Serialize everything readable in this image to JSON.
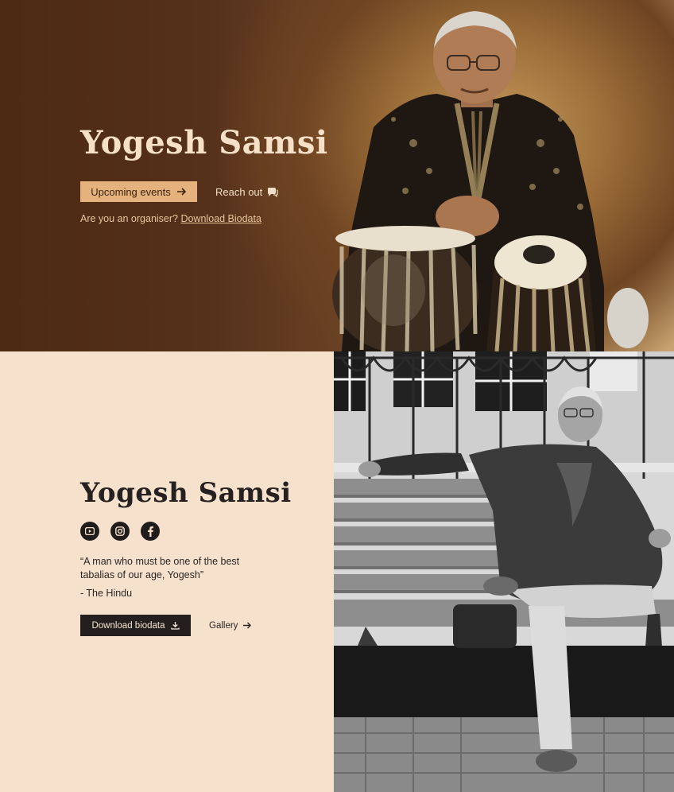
{
  "hero": {
    "title": "Yogesh Samsi",
    "upcoming_label": "Upcoming events",
    "reach_label": "Reach out",
    "organiser_text": "Are you an organiser? ",
    "biodata_link": "Download Biodata"
  },
  "about": {
    "title": "Yogesh Samsi",
    "socials": [
      "youtube-icon",
      "instagram-icon",
      "facebook-icon"
    ],
    "quote": "“A man who must be one of the best tabalias of our age, Yogesh”",
    "source": "- The Hindu",
    "download_label": "Download biodata",
    "gallery_label": "Gallery"
  },
  "colors": {
    "hero_bg": "#4c2a14",
    "accent": "#e5b27d",
    "section_bg": "#f6e2cc",
    "dark_button": "#231f1e"
  }
}
